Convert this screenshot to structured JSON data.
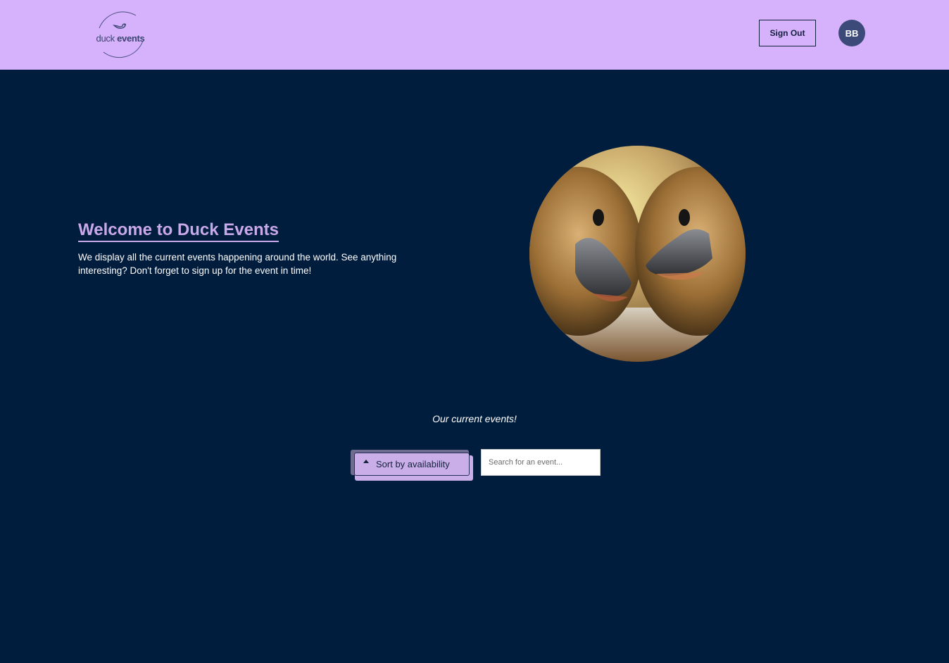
{
  "header": {
    "logo": {
      "text_regular": "duck ",
      "text_bold": "events"
    },
    "sign_out_label": "Sign Out",
    "avatar_initials": "BB"
  },
  "hero": {
    "title": "Welcome to Duck Events",
    "description": "We display all the current events happening around the world. See anything interesting? Don't forget to sign up for the event in time!"
  },
  "events": {
    "section_title": "Our current events!",
    "sort_label": "Sort by availability",
    "search_placeholder": "Search for an event..."
  },
  "colors": {
    "header_bg": "#d6b1fc",
    "page_bg": "#001d3d",
    "accent": "#caa9ea",
    "avatar_bg": "#3b4a78"
  }
}
